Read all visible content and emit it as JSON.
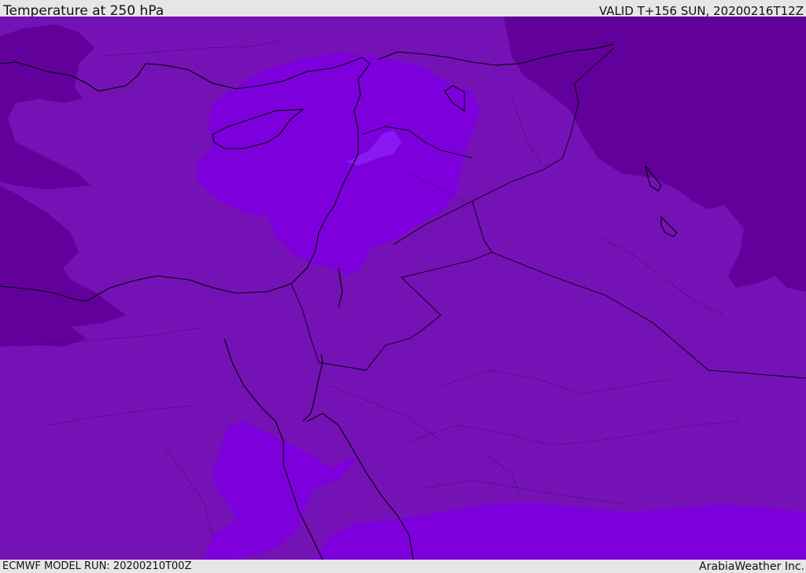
{
  "header": {
    "title": "Temperature at 250 hPa",
    "valid_time": "VALID T+156 SUN, 20200216T12Z"
  },
  "footer": {
    "model_run": "ECMWF MODEL RUN: 20200210T00Z",
    "credit": "ArabiaWeather Inc."
  },
  "map": {
    "region": "Eastern Mediterranean, Levant, Egypt and Arabian Peninsula",
    "colors": {
      "mid_purple": "#7512b6",
      "dark_purple": "#62009b",
      "bright_purple": "#7d00dc",
      "light_violet": "#8a18f2",
      "coastline": "#000000"
    }
  }
}
